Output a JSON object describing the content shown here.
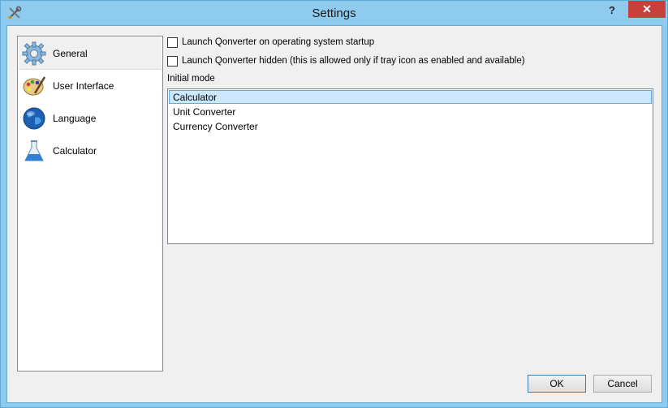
{
  "window": {
    "title": "Settings",
    "help_label": "?",
    "close_label": "✕"
  },
  "sidebar": {
    "items": [
      {
        "label": "General",
        "icon": "gear-icon",
        "selected": true
      },
      {
        "label": "User Interface",
        "icon": "palette-icon",
        "selected": false
      },
      {
        "label": "Language",
        "icon": "globe-icon",
        "selected": false
      },
      {
        "label": "Calculator",
        "icon": "flask-icon",
        "selected": false
      }
    ]
  },
  "general": {
    "startup_checkbox": {
      "label": "Launch Qonverter on operating system startup",
      "checked": false
    },
    "hidden_checkbox": {
      "label": "Launch Qonverter hidden (this is allowed only if tray icon as enabled and available)",
      "checked": false
    },
    "initial_mode_label": "Initial mode",
    "modes": [
      "Calculator",
      "Unit Converter",
      "Currency Converter"
    ],
    "selected_mode": "Calculator"
  },
  "buttons": {
    "ok": "OK",
    "cancel": "Cancel"
  }
}
